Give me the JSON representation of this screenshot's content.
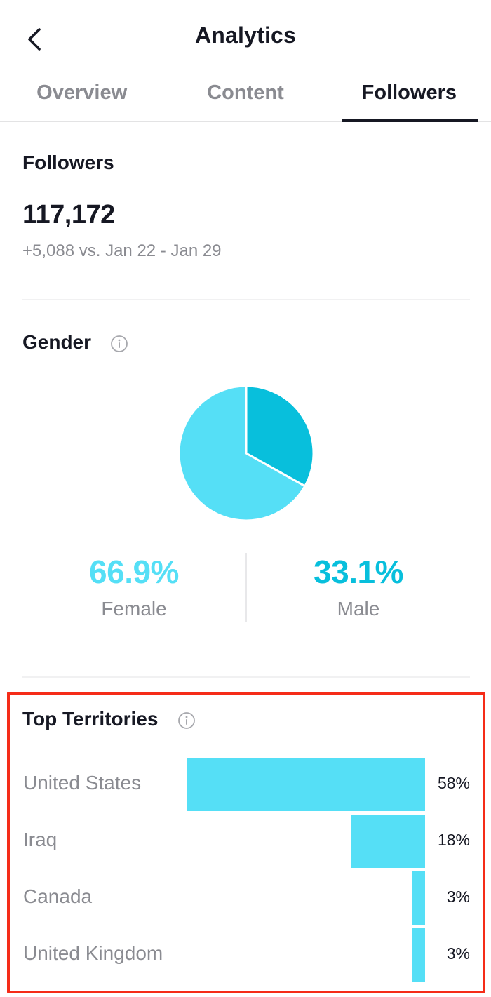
{
  "header": {
    "title": "Analytics"
  },
  "tabs": [
    {
      "label": "Overview",
      "active": false
    },
    {
      "label": "Content",
      "active": false
    },
    {
      "label": "Followers",
      "active": true
    }
  ],
  "followers": {
    "title": "Followers",
    "count": "117,172",
    "change_text": "+5,088 vs. Jan 22 - Jan 29"
  },
  "gender": {
    "title": "Gender",
    "info_icon": "info-circle-icon",
    "female": {
      "pct": "66.9%",
      "label": "Female",
      "value": 66.9,
      "color": "#55dff6"
    },
    "male": {
      "pct": "33.1%",
      "label": "Male",
      "value": 33.1,
      "color": "#08bfdc"
    }
  },
  "territories": {
    "title": "Top Territories",
    "info_icon": "info-circle-icon",
    "bar_color": "#55dff6",
    "items": [
      {
        "name": "United States",
        "pct": "58%",
        "value": 58
      },
      {
        "name": "Iraq",
        "pct": "18%",
        "value": 18
      },
      {
        "name": "Canada",
        "pct": "3%",
        "value": 3
      },
      {
        "name": "United Kingdom",
        "pct": "3%",
        "value": 3
      }
    ]
  }
}
